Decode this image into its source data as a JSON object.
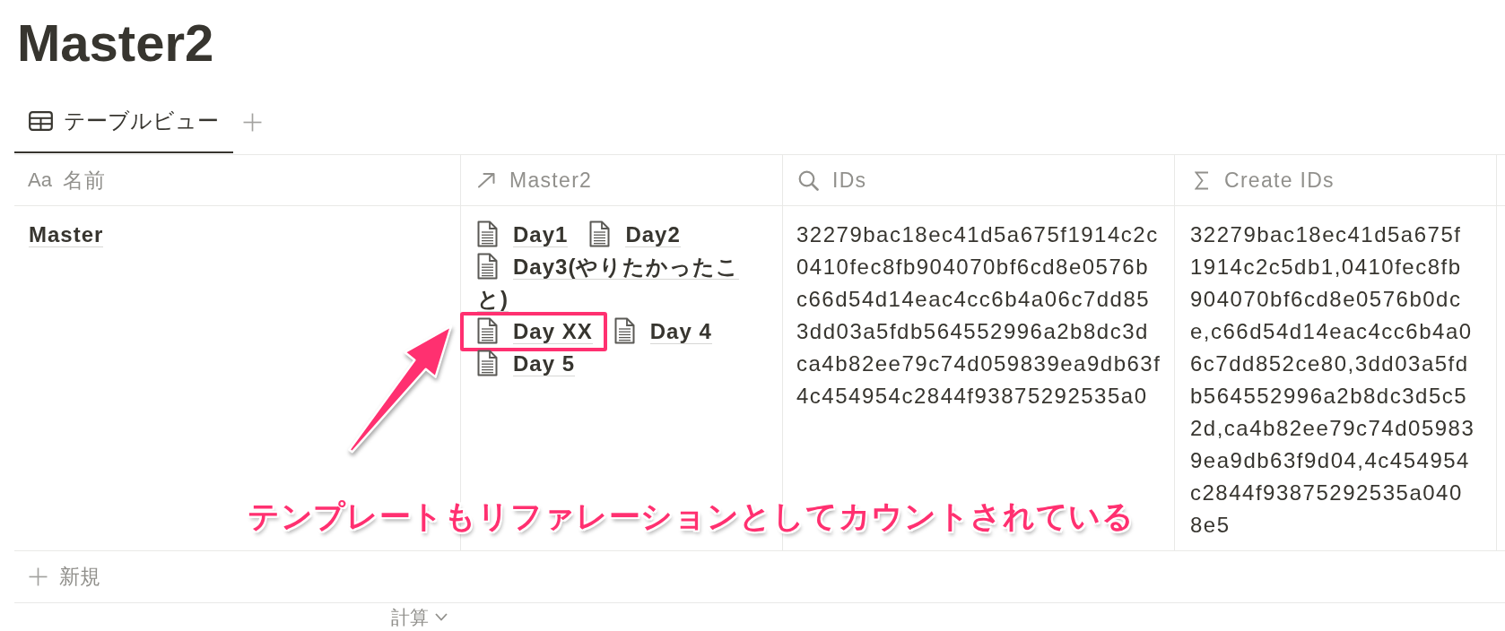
{
  "page": {
    "title": "Master2"
  },
  "views": {
    "tabs": [
      {
        "label": "テーブルビュー",
        "selected": true
      }
    ]
  },
  "table": {
    "columns": [
      {
        "kind": "title",
        "type_mark": "Aa",
        "label": "名前"
      },
      {
        "kind": "relation",
        "label": "Master2"
      },
      {
        "kind": "rollup",
        "label": "IDs"
      },
      {
        "kind": "formula",
        "label": "Create IDs"
      }
    ],
    "rows": [
      {
        "name": "Master",
        "relations": [
          {
            "title": "Day1",
            "highlighted": false
          },
          {
            "title": "Day2",
            "highlighted": false
          },
          {
            "title": "Day3(やりたかったこと)",
            "highlighted": false
          },
          {
            "title": "Day XX",
            "highlighted": true
          },
          {
            "title": "Day 4",
            "highlighted": false
          },
          {
            "title": "Day 5",
            "highlighted": false
          }
        ],
        "ids": [
          "32279bac18ec41d5a675f1914c2c",
          "0410fec8fb904070bf6cd8e0576b",
          "c66d54d14eac4cc6b4a06c7dd85",
          "3dd03a5fdb564552996a2b8dc3d",
          "ca4b82ee79c74d059839ea9db63f",
          "4c454954c2844f93875292535a0"
        ],
        "create_ids": [
          "32279bac18ec41d5a675f",
          "1914c2c5db1,0410fec8fb",
          "904070bf6cd8e0576b0dc",
          "e,c66d54d14eac4cc6b4a0",
          "6c7dd852ce80,3dd03a5fd",
          "b564552996a2b8dc3d5c5",
          "2d,ca4b82ee79c74d05983",
          "9ea9db63f9d04,4c454954",
          "c2844f93875292535a040",
          "8e5"
        ]
      }
    ],
    "new_row": {
      "label": "新規"
    },
    "footer": {
      "calculate": "計算"
    }
  },
  "annotation": {
    "text": "テンプレートもリファレーションとしてカウントされている"
  }
}
